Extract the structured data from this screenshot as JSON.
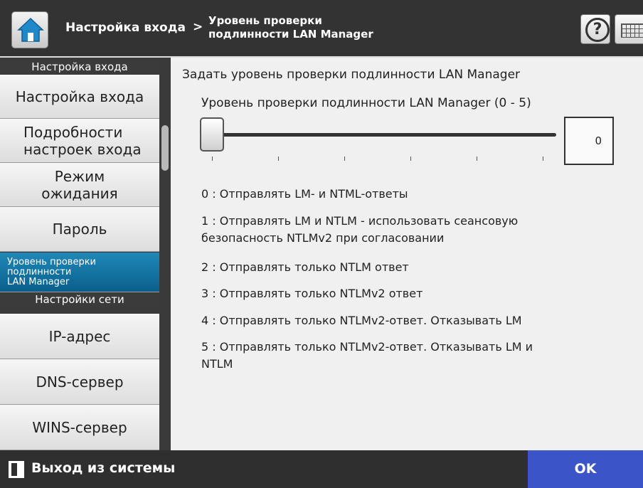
{
  "header": {
    "breadcrumb_parent": "Настройка входа",
    "breadcrumb_separator": ">",
    "breadcrumb_current_line1": "Уровень проверки",
    "breadcrumb_current_line2": "подлинности LAN Manager",
    "home_icon": "home-icon",
    "help_icon": "help-icon",
    "keyboard_icon": "keyboard-icon"
  },
  "sidebar": {
    "section1": "Настройка входа",
    "items1": [
      {
        "label": "Настройка входа"
      },
      {
        "label_line1": "Подробности",
        "label_line2": "настроек входа"
      },
      {
        "label_line1": "Режим",
        "label_line2": "ожидания"
      },
      {
        "label": "Пароль"
      },
      {
        "label_line1": "Уровень проверки",
        "label_line2": "подлинности",
        "label_line3": "LAN Manager",
        "selected": true
      }
    ],
    "section2": "Настройки сети",
    "items2": [
      {
        "label": "IP-адрес"
      },
      {
        "label": "DNS-сервер"
      },
      {
        "label": "WINS-сервер"
      }
    ]
  },
  "main": {
    "group_title": "Задать уровень проверки подлинности LAN Manager",
    "slider_label": "Уровень проверки подлинности LAN Manager (0 - 5)",
    "slider_min": 0,
    "slider_max": 5,
    "slider_value": 0,
    "value_display": "0",
    "options": [
      {
        "text": "0 : Отправлять LM- и NTML-ответы"
      },
      {
        "line1": "1 : Отправлять LM и NTLM - использовать сеансовую",
        "line2": "безопасность NTLMv2 при согласовании"
      },
      {
        "text": "2 : Отправлять только NTLM ответ"
      },
      {
        "text": "3 : Отправлять только NTLMv2 ответ"
      },
      {
        "text": "4 : Отправлять только NTLMv2-ответ. Отказывать LM"
      },
      {
        "line1": "5 : Отправлять только NTLMv2-ответ. Отказывать LM и",
        "line2": "NTLM"
      }
    ]
  },
  "footer": {
    "logout_label": "Выход из системы",
    "logout_icon": "logout-icon",
    "ok_label": "OK"
  },
  "colors": {
    "header_bg": "#333333",
    "sidebar_selected": "#1778a8",
    "ok_button": "#3b55c8"
  }
}
